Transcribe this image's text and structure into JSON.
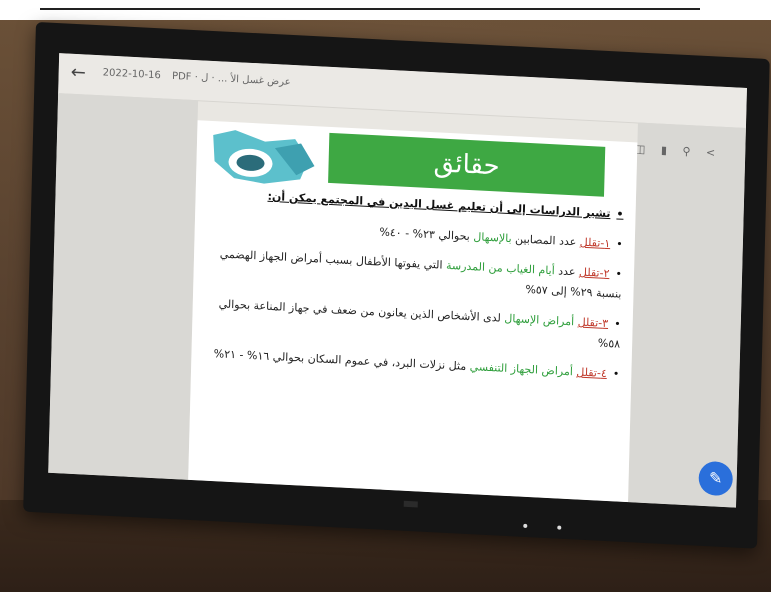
{
  "toolbar": {
    "date": "2022-10-16",
    "title": "PDF · عرض غسل الأ ... · ل"
  },
  "slide": {
    "banner": "حقائق",
    "heading": "تشير الدراسات إلى أن تعليم غسل اليدين في المجتمع يمكن أن:",
    "items": [
      {
        "num": "١-تقلل",
        "text": " عدد المصابين ",
        "green": "بالإسهال",
        "text2": " بحوالي ٢٣% - ٤٠%"
      },
      {
        "num": "٢-تقلل",
        "text": " عدد ",
        "green": "أيام الغياب من المدرسة",
        "text2": " التي يفوتها الأطفال بسبب أمراض الجهاز الهضمي بنسبة ٢٩% إلى ٥٧%"
      },
      {
        "num": "٣-تقلل",
        "text": " ",
        "green": "أمراض الإسهال",
        "text2": " لدى الأشخاص الذين يعانون من ضعف في جهاز المناعة بحوالي ٥٨%"
      },
      {
        "num": "٤-تقلل",
        "text": " ",
        "green": "أمراض الجهاز التنفسي",
        "text2": " مثل نزلات البرد، في عموم السكان بحوالي ١٦% - ٢١%"
      }
    ]
  },
  "colors": {
    "banner": "#3ea843",
    "fab": "#2a6fdb",
    "wall": "#5a4330"
  }
}
